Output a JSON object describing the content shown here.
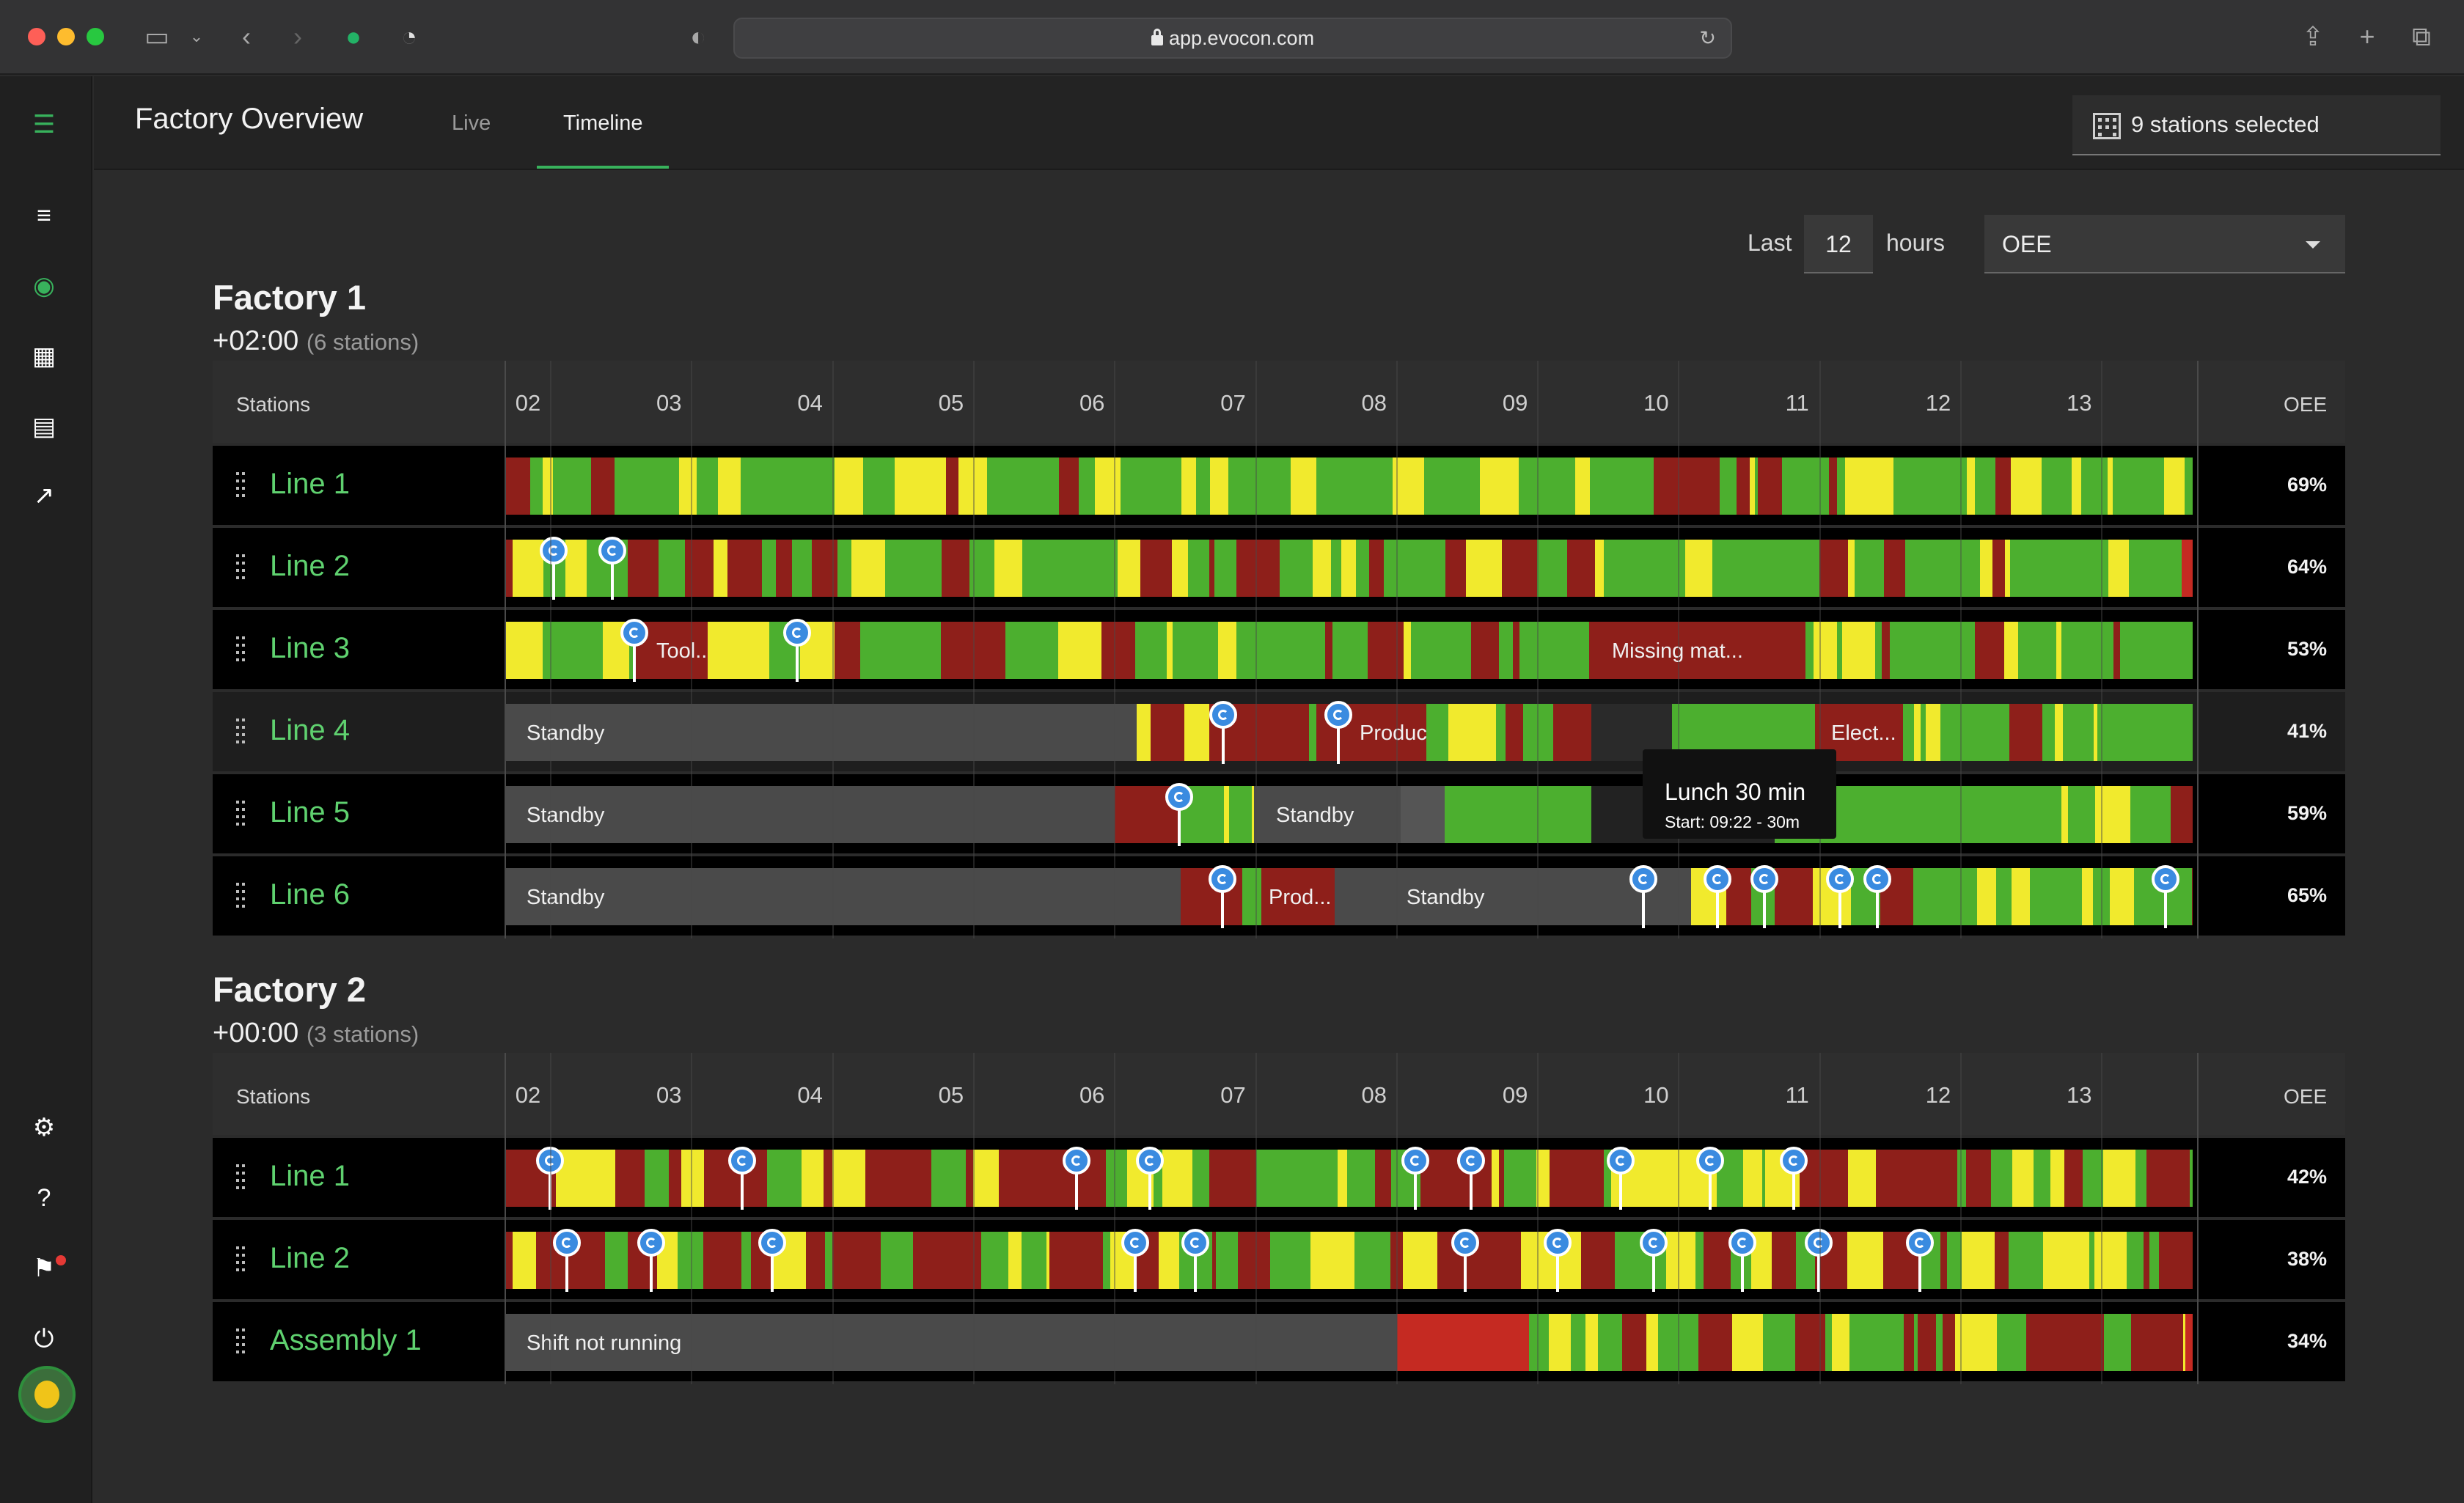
{
  "browser": {
    "url": "app.evocon.com"
  },
  "header": {
    "title": "Factory Overview",
    "tabs": [
      {
        "label": "Live"
      },
      {
        "label": "Timeline",
        "active": true
      }
    ],
    "stations_selected": "9 stations selected"
  },
  "controls": {
    "last_label": "Last",
    "hours_value": "12",
    "hours_label": "hours",
    "metric": "OEE"
  },
  "table_header": {
    "stations_label": "Stations",
    "oee_label": "OEE",
    "hours": [
      "02",
      "03",
      "04",
      "05",
      "06",
      "07",
      "08",
      "09",
      "10",
      "11",
      "12",
      "13"
    ]
  },
  "factories": [
    {
      "name": "Factory 1",
      "offset": "+02:00",
      "station_count": "(6 stations)",
      "lines": [
        {
          "name": "Line 1",
          "oee": "69%",
          "labels": []
        },
        {
          "name": "Line 2",
          "oee": "64%",
          "labels": []
        },
        {
          "name": "Line 3",
          "oee": "53%",
          "labels": [
            "Tool...",
            "Missing mat..."
          ]
        },
        {
          "name": "Line 4",
          "oee": "41%",
          "labels": [
            "Standby",
            "Product cha...",
            "Elect..."
          ]
        },
        {
          "name": "Line 5",
          "oee": "59%",
          "labels": [
            "Standby",
            "Standby"
          ]
        },
        {
          "name": "Line 6",
          "oee": "65%",
          "labels": [
            "Standby",
            "Prod...",
            "Standby"
          ]
        }
      ]
    },
    {
      "name": "Factory 2",
      "offset": "+00:00",
      "station_count": "(3 stations)",
      "lines": [
        {
          "name": "Line 1",
          "oee": "42%",
          "labels": []
        },
        {
          "name": "Line 2",
          "oee": "38%",
          "labels": []
        },
        {
          "name": "Assembly 1",
          "oee": "34%",
          "labels": [
            "Shift not running"
          ]
        }
      ]
    }
  ],
  "tooltip": {
    "title": "Lunch 30 min",
    "detail": "Start: 09:22 - 30m"
  },
  "colors": {
    "running": "#4caf2f",
    "slow": "#f1ea2d",
    "stopped": "#8e1f1a",
    "stopped_bright": "#c52a22",
    "standby": "#4a4a4a",
    "accent": "#38b25c",
    "marker": "#3a8be0"
  },
  "icons": [
    "menu-icon",
    "list-icon",
    "live-icon",
    "dashboard-icon",
    "report-icon",
    "trend-icon",
    "settings-icon",
    "help-icon",
    "flag-icon",
    "power-icon"
  ]
}
